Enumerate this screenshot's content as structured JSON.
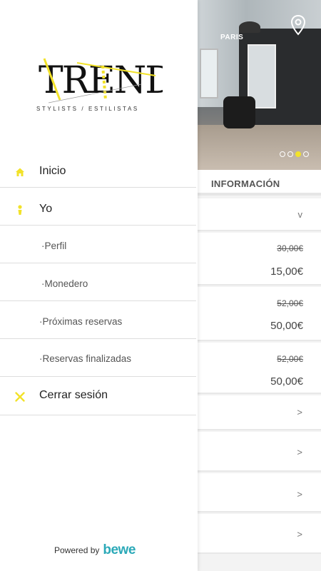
{
  "hero": {
    "sign_text": "PARIS",
    "carousel": {
      "count": 4,
      "active_index": 2
    }
  },
  "info": {
    "title": "INFORMACIÓN"
  },
  "services": [
    {
      "old_price": "30,00€",
      "price": "15,00€"
    },
    {
      "old_price": "52,00€",
      "price": "50,00€"
    },
    {
      "old_price": "52,00€",
      "price": "50,00€"
    }
  ],
  "chevrons": {
    "down": "v",
    "right": ">"
  },
  "drawer": {
    "logo_text": "TREND",
    "logo_subtitle": "STYLISTS  /  ESTILISTAS",
    "menu": {
      "inicio": "Inicio",
      "yo": "Yo",
      "perfil": "·Perfil",
      "monedero": "·Monedero",
      "proximas": "·Próximas reservas",
      "finalizadas": "·Reservas finalizadas",
      "cerrar": "Cerrar sesión"
    },
    "powered_by": "Powered by",
    "powered_brand": "bewe"
  },
  "colors": {
    "accent": "#f2e229",
    "brand": "#2ba9b8"
  }
}
